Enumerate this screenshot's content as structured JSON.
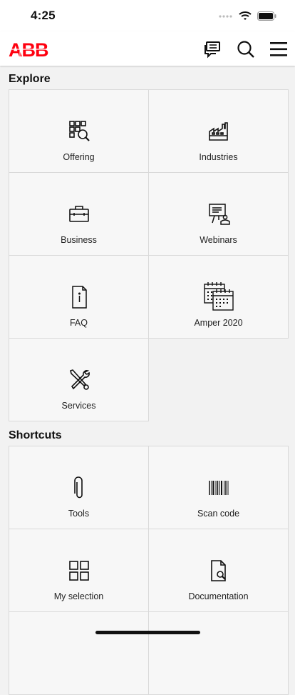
{
  "status": {
    "time": "4:25"
  },
  "header": {
    "logo_text": "ABB",
    "brand_color": "#ff000f",
    "icons": [
      "chat-icon",
      "search-icon",
      "menu-icon"
    ]
  },
  "explore": {
    "title": "Explore",
    "tiles": [
      {
        "label": "Offering",
        "icon": "offering-grid-search-icon"
      },
      {
        "label": "Industries",
        "icon": "factory-icon"
      },
      {
        "label": "Business",
        "icon": "briefcase-icon"
      },
      {
        "label": "Webinars",
        "icon": "presentation-icon"
      },
      {
        "label": "FAQ",
        "icon": "info-document-icon"
      },
      {
        "label": "Amper 2020",
        "icon": "calendar-icon"
      },
      {
        "label": "Services",
        "icon": "tools-icon"
      }
    ]
  },
  "shortcuts": {
    "title": "Shortcuts",
    "tiles": [
      {
        "label": "Tools",
        "icon": "paperclip-icon"
      },
      {
        "label": "Scan code",
        "icon": "barcode-icon"
      },
      {
        "label": "My selection",
        "icon": "grid-icon"
      },
      {
        "label": "Documentation",
        "icon": "document-search-icon"
      }
    ]
  }
}
